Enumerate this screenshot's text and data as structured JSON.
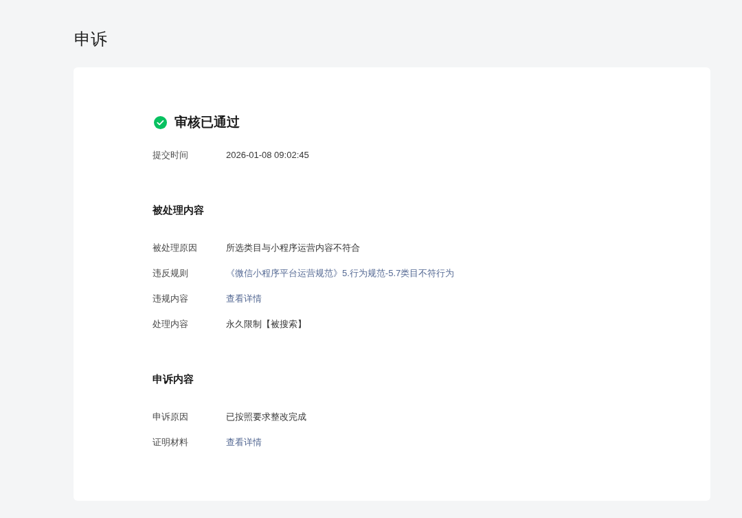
{
  "page": {
    "title": "申诉"
  },
  "status": {
    "approved": true,
    "title": "审核已通过"
  },
  "summary": [
    {
      "label": "提交时间",
      "value": "2026-01-08 09:02:45",
      "kind": "text"
    }
  ],
  "sections": [
    {
      "title": "被处理内容",
      "fields": [
        {
          "label": "被处理原因",
          "value": "所选类目与小程序运营内容不符合",
          "kind": "text"
        },
        {
          "label": "违反规则",
          "value": "《微信小程序平台运营规范》5.行为规范-5.7类目不符行为",
          "kind": "link"
        },
        {
          "label": "违规内容",
          "value": "查看详情",
          "kind": "link"
        },
        {
          "label": "处理内容",
          "value": "永久限制【被搜索】",
          "kind": "text"
        }
      ]
    },
    {
      "title": "申诉内容",
      "fields": [
        {
          "label": "申诉原因",
          "value": "已按照要求整改完成",
          "kind": "text"
        },
        {
          "label": "证明材料",
          "value": "查看详情",
          "kind": "link"
        }
      ]
    }
  ]
}
